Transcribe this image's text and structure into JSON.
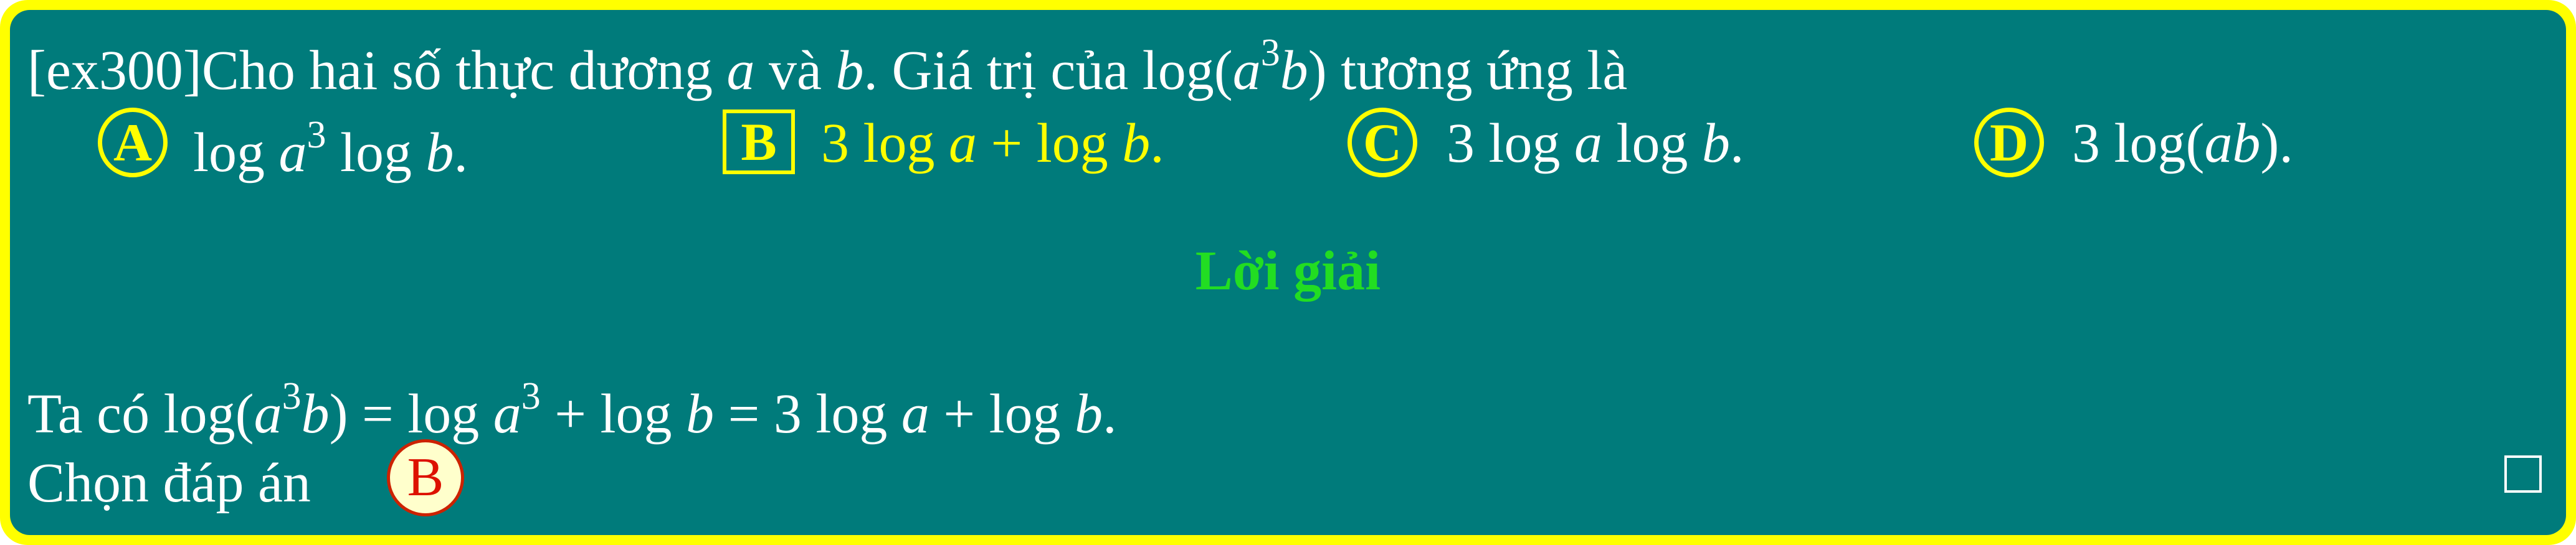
{
  "question": {
    "id_tag": "[ex300]",
    "text_before": "Cho hai số thực dương ",
    "var_a": "a",
    "text_and": " và ",
    "var_b": "b",
    "text_after": ". Giá trị của log(",
    "expr_a": "a",
    "expr_exp": "3",
    "expr_b": "b",
    "text_end": ") tương ứng là"
  },
  "options": [
    {
      "label": "A",
      "before": "log ",
      "var": "a",
      "exp": "3",
      "after": " log ",
      "var2": "b",
      "end": ".",
      "correct": false
    },
    {
      "label": "B",
      "text": "3 log ",
      "var": "a",
      "mid": " + log ",
      "var2": "b",
      "end": ".",
      "correct": true
    },
    {
      "label": "C",
      "text": "3 log ",
      "var": "a",
      "mid": " log ",
      "var2": "b",
      "end": ".",
      "correct": false
    },
    {
      "label": "D",
      "text": "3 log(",
      "var": "ab",
      "end": ")."
    }
  ],
  "solution": {
    "heading": "Lời giải",
    "line1_start": "Ta có log(",
    "line1_a": "a",
    "line1_exp": "3",
    "line1_b": "b",
    "line1_eq1": ") = log ",
    "line1_a2": "a",
    "line1_exp2": "3",
    "line1_plus": " + log ",
    "line1_b2": "b",
    "line1_eq2": " = 3 log ",
    "line1_a3": "a",
    "line1_plus2": " + log ",
    "line1_b3": "b",
    "line1_end": ".",
    "line2": "Chọn đáp án",
    "answer": "B"
  },
  "colors": {
    "frame": "#ffff00",
    "background": "#007b7b",
    "heading": "#22dd22",
    "answer_badge_text": "#dd1100",
    "answer_badge_fill": "#ffffcc"
  },
  "icons": {
    "end_of_proof": "qed-square-icon"
  }
}
